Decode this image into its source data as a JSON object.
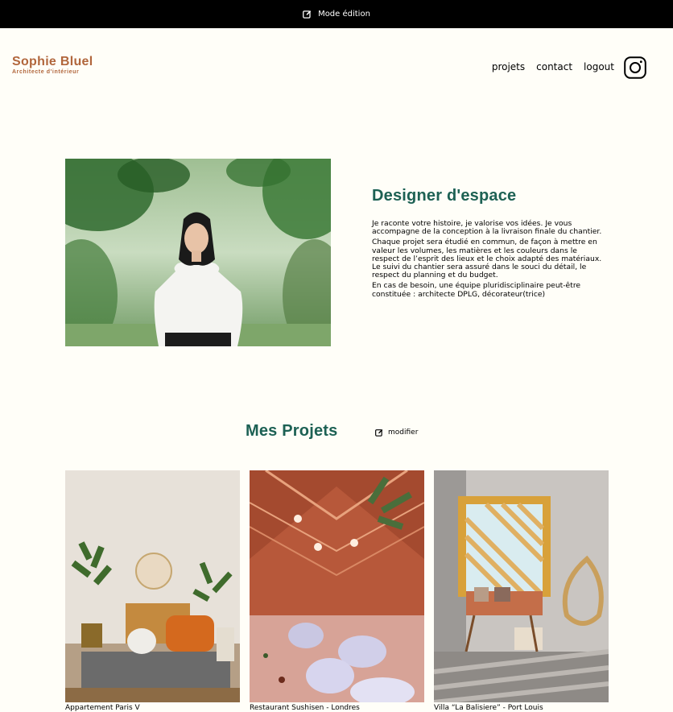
{
  "edit_bar": {
    "label": "Mode édition",
    "icon": "edit-icon"
  },
  "logo": {
    "name": "Sophie Bluel",
    "subtitle": "Architecte d'intérieur"
  },
  "nav": {
    "projects": "projets",
    "contact": "contact",
    "logout": "logout",
    "instagram_icon": "instagram-icon"
  },
  "intro": {
    "title": "Designer d'espace",
    "paragraphs": [
      "Je raconte votre histoire, je valorise vos idées. Je vous accompagne de la conception à la livraison finale du chantier.",
      "Chaque projet sera étudié en commun, de façon à mettre en valeur les volumes, les matières et les couleurs dans le respect de l’esprit des lieux et le choix adapté des matériaux. Le suivi du chantier sera assuré dans le souci du détail, le respect du planning et du budget.",
      "En cas de besoin, une équipe pluridisciplinaire peut-être constituée : architecte DPLG, décorateur(trice)"
    ]
  },
  "projects": {
    "title": "Mes Projets",
    "modify_label": "modifier",
    "items": [
      {
        "caption": "Appartement Paris V"
      },
      {
        "caption": "Restaurant Sushisen - Londres"
      },
      {
        "caption": "Villa “La Balisiere” - Port Louis"
      }
    ]
  },
  "colors": {
    "accent_green": "#1d6154",
    "brand_orange": "#b1663c",
    "background": "#fffef8"
  }
}
